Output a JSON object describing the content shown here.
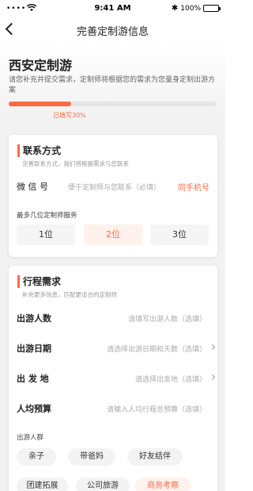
{
  "status_bar": {
    "signal": "••••",
    "time": "9:41 AM",
    "bluetooth": "✱",
    "battery": "100%"
  },
  "nav": {
    "title": "完善定制游信息"
  },
  "hero": {
    "destination": "西安定制游",
    "description": "请您补充并提交需求，定制师将根据您的需求为您量身定制出游方案",
    "progress_percent": 30,
    "progress_label": "已填写30%"
  },
  "contact": {
    "title": "联系方式",
    "subtitle": "完善联系方式，我们将根据需求与您联系",
    "wechat_label": "微 信 号",
    "wechat_placeholder": "便于定制师与您联系（必填）",
    "same_phone": "同手机号",
    "service_label": "最多几位定制师服务",
    "options": [
      "1位",
      "2位",
      "3位"
    ],
    "selected": "2位"
  },
  "trip": {
    "title": "行程需求",
    "subtitle": "补充更多信息，匹配更适合的定制师",
    "rows": [
      {
        "label": "出游人数",
        "placeholder": "请填写出游人数（选填）"
      },
      {
        "label": "出游日期",
        "placeholder": "请选择出游日期和天数（选填）"
      },
      {
        "label": "出 发 地",
        "placeholder": "请选择出发地（选填）"
      },
      {
        "label": "人均预算",
        "placeholder": "请输入人均行程总预算（选填）"
      }
    ],
    "group_label": "出游人群",
    "groups": [
      "亲子",
      "带爸妈",
      "好友结伴",
      "团建拓展",
      "公司旅游",
      "商务考察"
    ],
    "selected_group": "商务考察"
  },
  "colors": {
    "accent": "#ff6b45",
    "background": "#f2f2f2"
  }
}
